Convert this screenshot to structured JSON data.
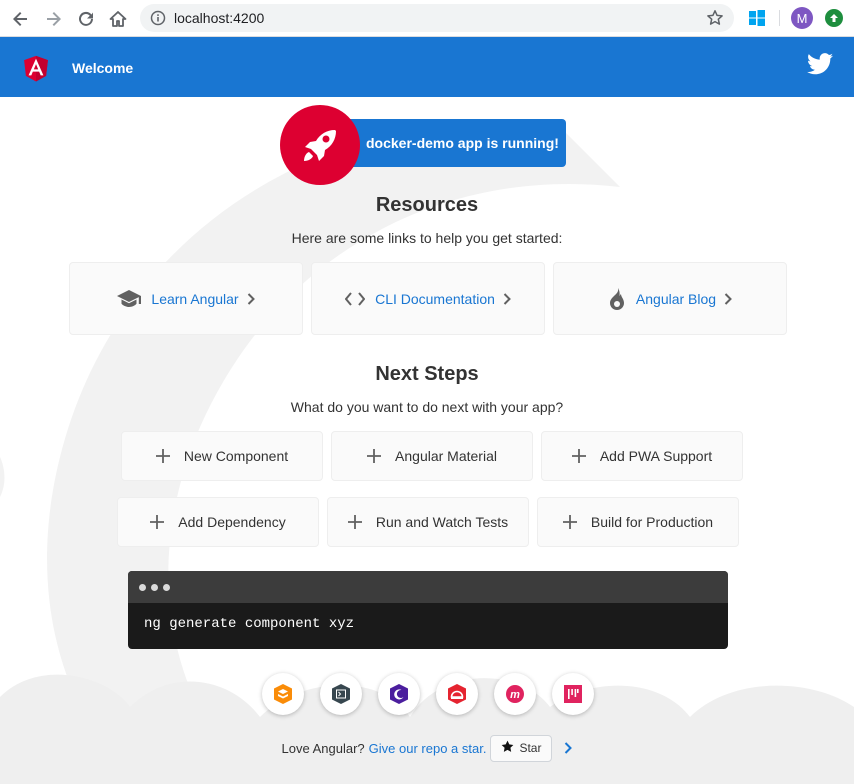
{
  "browser": {
    "url": "localhost:4200",
    "avatar_letter": "M",
    "icons": [
      "back-icon",
      "forward-icon",
      "reload-icon",
      "home-icon",
      "info-icon",
      "bookmark-star-icon",
      "windows-extension-icon",
      "update-icon"
    ]
  },
  "toolbar": {
    "title": "Welcome",
    "accent": "#1976d2"
  },
  "hero": {
    "message": "docker-demo app is running!",
    "rocket_color": "#dd0031"
  },
  "resources": {
    "heading": "Resources",
    "subtitle": "Here are some links to help you get started:",
    "links": [
      {
        "label": "Learn Angular",
        "icon": "graduation-cap-icon"
      },
      {
        "label": "CLI Documentation",
        "icon": "code-brackets-icon"
      },
      {
        "label": "Angular Blog",
        "icon": "flame-icon"
      }
    ]
  },
  "next_steps": {
    "heading": "Next Steps",
    "subtitle": "What do you want to do next with your app?",
    "items": [
      {
        "label": "New Component"
      },
      {
        "label": "Angular Material"
      },
      {
        "label": "Add PWA Support"
      },
      {
        "label": "Add Dependency"
      },
      {
        "label": "Run and Watch Tests"
      },
      {
        "label": "Build for Production"
      }
    ]
  },
  "terminal": {
    "command": "ng generate component xyz"
  },
  "ecosystem": {
    "icons": [
      "animations-icon",
      "cli-icon",
      "ngrx-icon",
      "protractor-icon",
      "meetup-icon",
      "discord-icon"
    ]
  },
  "footer": {
    "text": "Love Angular?",
    "link": "Give our repo a star.",
    "star_label": "Star"
  }
}
